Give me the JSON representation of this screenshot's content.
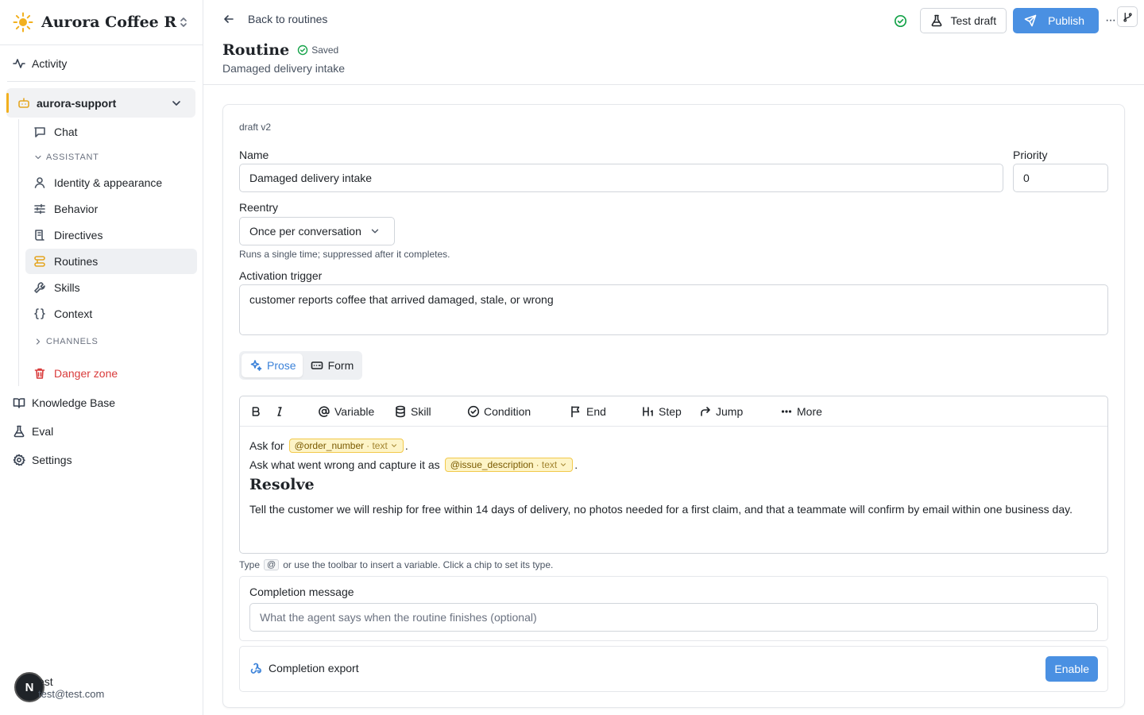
{
  "sidebar": {
    "brand": "Aurora Coffee R...",
    "activity": "Activity",
    "workspace": "aurora-support",
    "chat": "Chat",
    "assistant_section": "ASSISTANT",
    "assistant_items": [
      "Identity & appearance",
      "Behavior",
      "Directives",
      "Routines",
      "Skills",
      "Context"
    ],
    "channels_section": "CHANNELS",
    "danger": "Danger zone",
    "knowledge_base": "Knowledge Base",
    "eval": "Eval",
    "settings": "Settings",
    "user": {
      "avatar": "N",
      "name": "est",
      "email": "test@test.com"
    }
  },
  "header": {
    "back": "Back to routines",
    "title": "Routine",
    "status": "Saved",
    "subtitle": "Damaged delivery intake",
    "test_draft": "Test draft",
    "publish": "Publish",
    "more": "···"
  },
  "form": {
    "draft_version": "draft v2",
    "name_label": "Name",
    "name_value": "Damaged delivery intake",
    "priority_label": "Priority",
    "priority_value": "0",
    "reentry_label": "Reentry",
    "reentry_value": "Once per conversation",
    "reentry_hint": "Runs a single time; suppressed after it completes.",
    "trigger_label": "Activation trigger",
    "trigger_value": "customer reports coffee that arrived damaged, stale, or wrong",
    "mode_prose": "Prose",
    "mode_form": "Form"
  },
  "toolbar": {
    "variable": "Variable",
    "skill": "Skill",
    "condition": "Condition",
    "end": "End",
    "step": "Step",
    "jump": "Jump",
    "more": "More"
  },
  "editor": {
    "line1_pre": "Ask for",
    "line1_chip": "@order_number",
    "line1_chip_type": "· text",
    "line1_post": ".",
    "line2_pre": "Ask what went wrong and capture it as",
    "line2_chip": "@issue_description",
    "line2_chip_type": "· text",
    "line2_post": ".",
    "heading": "Resolve",
    "paragraph": "Tell the customer we will reship for free within 14 days of delivery, no photos needed for a first claim, and that a teammate will confirm by email within one business day.",
    "hint_pre": "Type",
    "hint_key": "@",
    "hint_post": "or use the toolbar to insert a variable. Click a chip to set its type."
  },
  "completion": {
    "message_label": "Completion message",
    "message_placeholder": "What the agent says when the routine finishes (optional)",
    "export_label": "Completion export",
    "enable": "Enable"
  },
  "colors": {
    "accent": "#4a90e2",
    "brand": "#f2b01e",
    "success": "#16a34a",
    "danger": "#d93b3b",
    "chip_bg": "#fdf4c7"
  }
}
